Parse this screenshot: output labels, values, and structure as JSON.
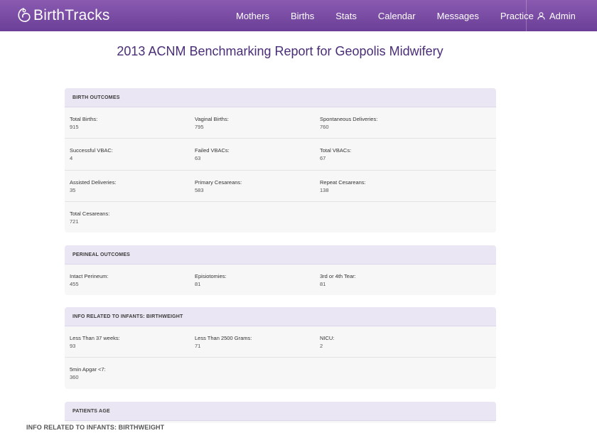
{
  "brand": {
    "name": "BirthTracks"
  },
  "nav": {
    "links": [
      "Mothers",
      "Births",
      "Stats",
      "Calendar",
      "Messages",
      "Practice"
    ],
    "admin_label": "Admin"
  },
  "page": {
    "title": "2013 ACNM Benchmarking Report for Geopolis Midwifery"
  },
  "sections": [
    {
      "header": "Birth Outcomes",
      "rows": [
        [
          {
            "label": "Total Births:",
            "value": "915"
          },
          {
            "label": "Vaginal Births:",
            "value": "795"
          },
          {
            "label": "Spontaneous Deliveries:",
            "value": "760"
          }
        ],
        [
          {
            "label": "Successful VBAC:",
            "value": "4"
          },
          {
            "label": "Failed VBACs:",
            "value": "63"
          },
          {
            "label": "Total VBACs:",
            "value": "67"
          }
        ],
        [
          {
            "label": "Assisted Deliveries:",
            "value": "35"
          },
          {
            "label": "Primary Cesareans:",
            "value": "583"
          },
          {
            "label": "Repeat Cesareans:",
            "value": "138"
          }
        ],
        [
          {
            "label": "Total Cesareans:",
            "value": "721"
          }
        ]
      ]
    },
    {
      "header": "Perineal Outcomes",
      "rows": [
        [
          {
            "label": "Intact Perineum:",
            "value": "455"
          },
          {
            "label": "Episiotomies:",
            "value": "81"
          },
          {
            "label": "3rd or 4th Tear:",
            "value": "81"
          }
        ]
      ]
    },
    {
      "header": "Info Related to Infants: Birthweight",
      "rows": [
        [
          {
            "label": "Less Than 37 weeks:",
            "value": "93"
          },
          {
            "label": "Less Than 2500 Grams:",
            "value": "71"
          },
          {
            "label": "NICU:",
            "value": "2"
          }
        ],
        [
          {
            "label": "5min Apgar <7:",
            "value": "360"
          }
        ]
      ]
    },
    {
      "header": "Patients Age",
      "rows": []
    }
  ],
  "footer_ghost": "Info Related to Infants: Birthweight",
  "colors": {
    "nav_bg": "#7a4ca6",
    "title": "#4a2d77",
    "panel_header": "#ebe6f3"
  }
}
